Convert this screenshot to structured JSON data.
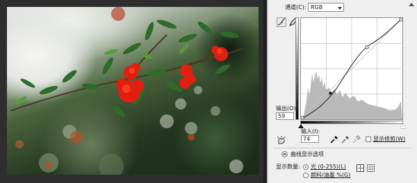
{
  "channel": {
    "label": "通道(C):",
    "value": "RGB"
  },
  "curve": {
    "output": 59,
    "input": 74
  },
  "output": {
    "label": "输出(O):",
    "value": "59"
  },
  "input": {
    "label": "输入(I):",
    "value": "74"
  },
  "show_clipping": {
    "label": "显示修剪(W)",
    "checked": false
  },
  "curve_display": {
    "label": "曲线显示选项"
  },
  "show_amount": {
    "label": "显示数量:",
    "options": [
      {
        "label": "光 (0-255)(L)",
        "selected": true
      },
      {
        "label": "颜料/油墨 %(G)",
        "selected": false
      }
    ]
  },
  "icons": [
    "curve-point-icon",
    "pencil-icon",
    "target-adjust-icon",
    "black-eyedropper-icon",
    "gray-eyedropper-icon",
    "white-eyedropper-icon",
    "expand-icon",
    "simple-grid-icon",
    "detailed-grid-icon",
    "scroll-arrow-icon"
  ]
}
